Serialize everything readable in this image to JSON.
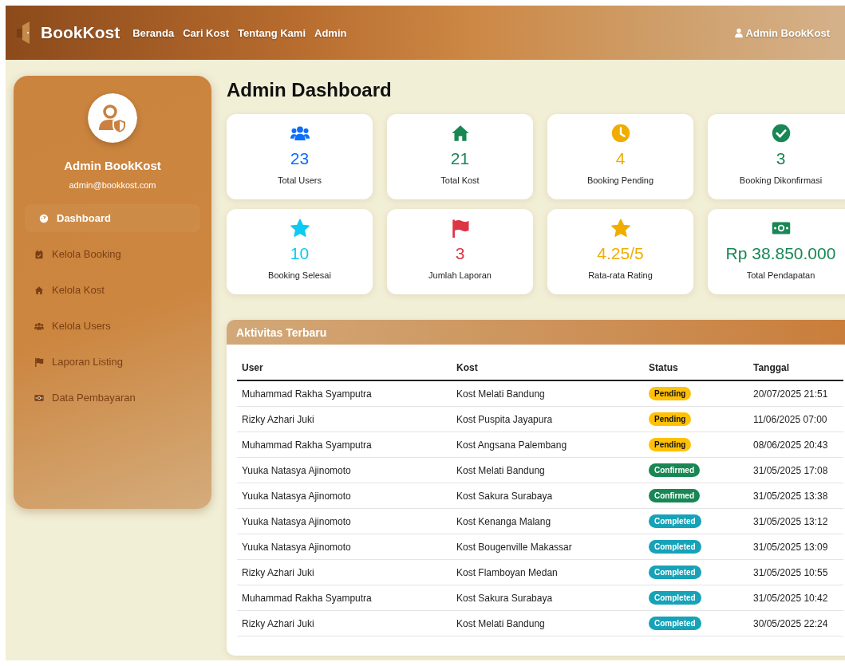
{
  "navbar": {
    "brand": "BookKost",
    "links": [
      {
        "label": "Beranda"
      },
      {
        "label": "Cari Kost"
      },
      {
        "label": "Tentang Kami"
      },
      {
        "label": "Admin"
      }
    ],
    "user": "Admin BookKost"
  },
  "sidebar": {
    "name": "Admin BookKost",
    "email": "admin@bookkost.com",
    "items": [
      {
        "label": "Dashboard",
        "selected": true
      },
      {
        "label": "Kelola Booking",
        "selected": false
      },
      {
        "label": "Kelola Kost",
        "selected": false
      },
      {
        "label": "Kelola Users",
        "selected": false
      },
      {
        "label": "Laporan Listing",
        "selected": false
      },
      {
        "label": "Data Pembayaran",
        "selected": false
      }
    ]
  },
  "page_title": "Admin Dashboard",
  "stats": [
    {
      "value": "23",
      "label": "Total Users",
      "color": "#0d6efd"
    },
    {
      "value": "21",
      "label": "Total Kost",
      "color": "#198754"
    },
    {
      "value": "4",
      "label": "Booking Pending",
      "color": "#f0ad00"
    },
    {
      "value": "3",
      "label": "Booking Dikonfirmasi",
      "color": "#198754"
    },
    {
      "value": "10",
      "label": "Booking Selesai",
      "color": "#0dcaf0"
    },
    {
      "value": "3",
      "label": "Jumlah Laporan",
      "color": "#dc3545"
    },
    {
      "value": "4.25/5",
      "label": "Rata-rata Rating",
      "color": "#f0ad00"
    },
    {
      "value": "Rp 38.850.000",
      "label": "Total Pendapatan",
      "color": "#198754"
    }
  ],
  "activity": {
    "title": "Aktivitas Terbaru",
    "columns": [
      "User",
      "Kost",
      "Status",
      "Tanggal"
    ],
    "rows": [
      {
        "user": "Muhammad Rakha Syamputra",
        "kost": "Kost Melati Bandung",
        "status": "Pending",
        "kind": "pending",
        "date": "20/07/2025 21:51"
      },
      {
        "user": "Rizky Azhari Juki",
        "kost": "Kost Puspita Jayapura",
        "status": "Pending",
        "kind": "pending",
        "date": "11/06/2025 07:00"
      },
      {
        "user": "Muhammad Rakha Syamputra",
        "kost": "Kost Angsana Palembang",
        "status": "Pending",
        "kind": "pending",
        "date": "08/06/2025 20:43"
      },
      {
        "user": "Yuuka Natasya Ajinomoto",
        "kost": "Kost Melati Bandung",
        "status": "Confirmed",
        "kind": "confirmed",
        "date": "31/05/2025 17:08"
      },
      {
        "user": "Yuuka Natasya Ajinomoto",
        "kost": "Kost Sakura Surabaya",
        "status": "Confirmed",
        "kind": "confirmed",
        "date": "31/05/2025 13:38"
      },
      {
        "user": "Yuuka Natasya Ajinomoto",
        "kost": "Kost Kenanga Malang",
        "status": "Completed",
        "kind": "completed",
        "date": "31/05/2025 13:12"
      },
      {
        "user": "Yuuka Natasya Ajinomoto",
        "kost": "Kost Bougenville Makassar",
        "status": "Completed",
        "kind": "completed",
        "date": "31/05/2025 13:09"
      },
      {
        "user": "Rizky Azhari Juki",
        "kost": "Kost Flamboyan Medan",
        "status": "Completed",
        "kind": "completed",
        "date": "31/05/2025 10:55"
      },
      {
        "user": "Muhammad Rakha Syamputra",
        "kost": "Kost Sakura Surabaya",
        "status": "Completed",
        "kind": "completed",
        "date": "31/05/2025 10:42"
      },
      {
        "user": "Rizky Azhari Juki",
        "kost": "Kost Melati Bandung",
        "status": "Completed",
        "kind": "completed",
        "date": "30/05/2025 22:24"
      }
    ]
  }
}
